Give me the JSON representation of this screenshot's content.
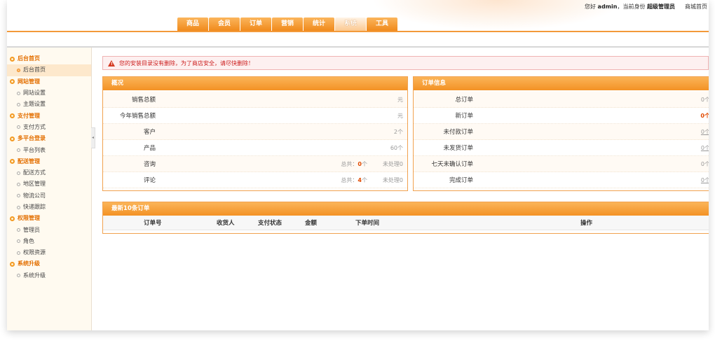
{
  "header": {
    "greeting_prefix": "您好",
    "username": "admin",
    "greeting_mid": "，当前身份",
    "role": "超级管理员",
    "shop_home": "商城首页",
    "tabs": [
      {
        "label": "商品"
      },
      {
        "label": "会员"
      },
      {
        "label": "订单"
      },
      {
        "label": "营销"
      },
      {
        "label": "统计"
      },
      {
        "label": "系统",
        "active": true
      },
      {
        "label": "工具"
      }
    ]
  },
  "sidebar": {
    "groups": [
      {
        "title": "后台首页",
        "items": [
          {
            "label": "后台首页",
            "active": true
          }
        ]
      },
      {
        "title": "网站管理",
        "items": [
          {
            "label": "网站设置"
          },
          {
            "label": "主题设置"
          }
        ]
      },
      {
        "title": "支付管理",
        "items": [
          {
            "label": "支付方式"
          }
        ]
      },
      {
        "title": "多平台登录",
        "items": [
          {
            "label": "平台列表"
          }
        ]
      },
      {
        "title": "配送管理",
        "items": [
          {
            "label": "配送方式"
          },
          {
            "label": "地区管理"
          },
          {
            "label": "物流公司"
          },
          {
            "label": "快递跟踪"
          }
        ]
      },
      {
        "title": "权限管理",
        "items": [
          {
            "label": "管理员"
          },
          {
            "label": "角色"
          },
          {
            "label": "权限资源"
          }
        ]
      },
      {
        "title": "系统升级",
        "items": [
          {
            "label": "系统升级"
          }
        ]
      }
    ]
  },
  "alert": {
    "text": "您的安装目录没有删除，为了商店安全，请尽快删除！"
  },
  "overview": {
    "title": "概况",
    "rows": [
      {
        "label": "销售总额",
        "value": "元"
      },
      {
        "label": "今年销售总额",
        "value": "元"
      },
      {
        "label": "客户",
        "value": "2个"
      },
      {
        "label": "产品",
        "value": "60个"
      },
      {
        "label": "咨询",
        "total_prefix": "总共：",
        "total_num": "0",
        "total_unit": "个",
        "pending": "未处理0"
      },
      {
        "label": "评论",
        "total_prefix": "总共：",
        "total_num": "4",
        "total_unit": "个",
        "pending": "未处理0"
      }
    ]
  },
  "orders": {
    "title": "订单信息",
    "rows": [
      {
        "label": "总订单",
        "value": "0个",
        "style": "plain"
      },
      {
        "label": "新订单",
        "value": "0个",
        "style": "red"
      },
      {
        "label": "未付款订单",
        "value": "0个",
        "style": "link"
      },
      {
        "label": "未发货订单",
        "value": "0个",
        "style": "link"
      },
      {
        "label": "七天未确认订单",
        "value": "0个",
        "style": "plain"
      },
      {
        "label": "完成订单",
        "value": "0个",
        "style": "link"
      }
    ]
  },
  "latest": {
    "title": "最新10条订单",
    "columns": [
      "订单号",
      "收货人",
      "支付状态",
      "金额",
      "下单时间",
      "操作"
    ]
  }
}
